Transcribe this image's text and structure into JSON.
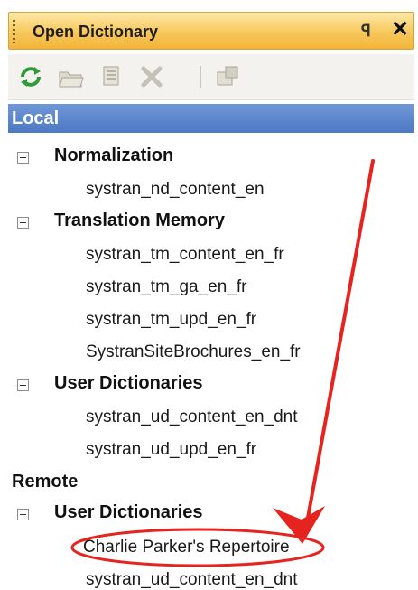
{
  "window": {
    "title": "Open Dictionary",
    "pin_glyph": "ꟼ",
    "close_glyph": "✕"
  },
  "toolbar": {
    "buttons": [
      {
        "icon": "refresh-icon"
      },
      {
        "icon": "open-folder-icon"
      },
      {
        "icon": "import-icon"
      },
      {
        "icon": "delete-icon"
      },
      {
        "icon": "properties-icon"
      }
    ]
  },
  "local": {
    "label": "Local",
    "groups": [
      {
        "label": "Normalization",
        "items": [
          "systran_nd_content_en"
        ]
      },
      {
        "label": "Translation Memory",
        "items": [
          "systran_tm_content_en_fr",
          "systran_tm_ga_en_fr",
          "systran_tm_upd_en_fr",
          "SystranSiteBrochures_en_fr"
        ]
      },
      {
        "label": "User Dictionaries",
        "items": [
          "systran_ud_content_en_dnt",
          "systran_ud_upd_en_fr"
        ]
      }
    ]
  },
  "remote": {
    "label": "Remote",
    "groups": [
      {
        "label": "User Dictionaries",
        "items": [
          "Charlie Parker's Repertoire",
          "systran_ud_content_en_dnt"
        ]
      }
    ]
  },
  "annotation": {
    "color": "#e52420"
  }
}
